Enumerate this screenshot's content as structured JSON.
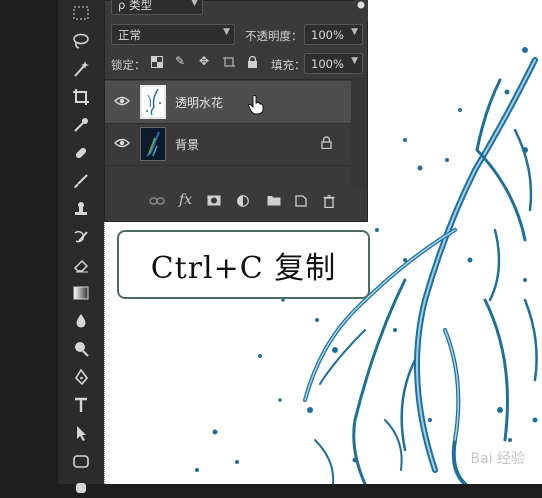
{
  "layers_panel": {
    "filter_label": "ρ 类型",
    "blend_mode": "正常",
    "opacity_label": "不透明度：",
    "opacity_value": "100%",
    "lock_label": "锁定：",
    "fill_label": "填充：",
    "fill_value": "100%",
    "layers": [
      {
        "name": "透明水花",
        "visible": true,
        "selected": true
      },
      {
        "name": "背景",
        "visible": true,
        "selected": false,
        "locked": true
      }
    ],
    "bottom_icons": [
      "link-icon",
      "fx-icon",
      "mask-icon",
      "adjustment-icon",
      "folder-icon",
      "new-layer-icon",
      "trash-icon"
    ]
  },
  "callout": {
    "text": "Ctrl+C 复制"
  },
  "watermark": "Bai 经验",
  "toolbar": {
    "tools": [
      "marquee-icon",
      "lasso-icon",
      "magic-wand-icon",
      "crop-icon",
      "eyedropper-icon",
      "healing-icon",
      "brush-icon",
      "stamp-icon",
      "history-brush-icon",
      "eraser-icon",
      "gradient-icon",
      "blur-icon",
      "dodge-icon",
      "pen-icon",
      "type-icon",
      "path-select-icon",
      "shape-icon",
      "hand-icon"
    ]
  },
  "colors": {
    "panel_bg": "#3a3a3a",
    "selected_row": "#4e4e4e",
    "splash_blue": "#1f6f9c",
    "callout_border": "#4a6e63"
  }
}
